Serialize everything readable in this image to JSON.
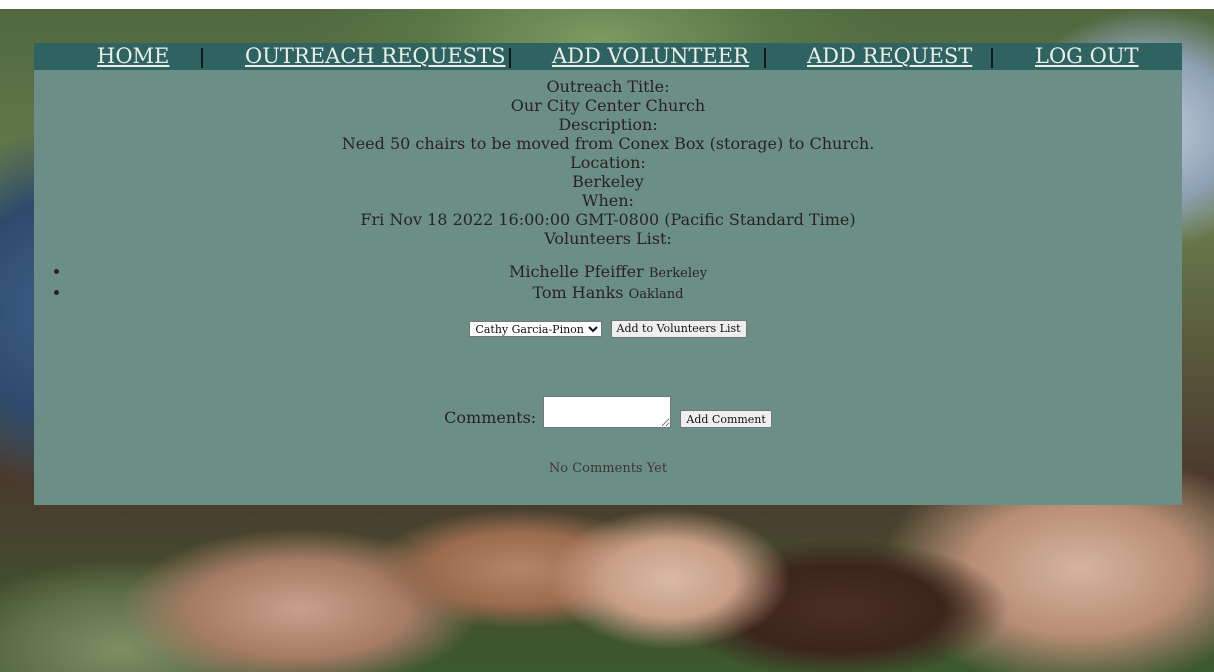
{
  "nav": {
    "items": [
      {
        "label": "HOME"
      },
      {
        "label": "OUTREACH REQUESTS"
      },
      {
        "label": "ADD VOLUNTEER"
      },
      {
        "label": "ADD REQUEST"
      },
      {
        "label": "LOG OUT"
      }
    ]
  },
  "outreach": {
    "title_label": "Outreach Title:",
    "title_value": "Our City Center Church",
    "description_label": "Description:",
    "description_value": "Need 50 chairs to be moved from Conex Box (storage) to Church.",
    "location_label": "Location:",
    "location_value": "Berkeley",
    "when_label": "When:",
    "when_value": "Fri Nov 18 2022 16:00:00 GMT-0800 (Pacific Standard Time)",
    "volunteers_label": "Volunteers List:"
  },
  "volunteers": [
    {
      "name": "Michelle Pfeiffer",
      "city": "Berkeley"
    },
    {
      "name": "Tom Hanks",
      "city": "Oakland"
    }
  ],
  "add_volunteer": {
    "selected": "Cathy Garcia-Pinon",
    "button_label": "Add to Volunteers List"
  },
  "comments": {
    "label": "Comments:",
    "button_label": "Add Comment",
    "empty_text": "No Comments Yet"
  },
  "colors": {
    "nav_bg": "#2e6361",
    "panel_bg": "#6b8f87",
    "text": "#2a2222"
  }
}
